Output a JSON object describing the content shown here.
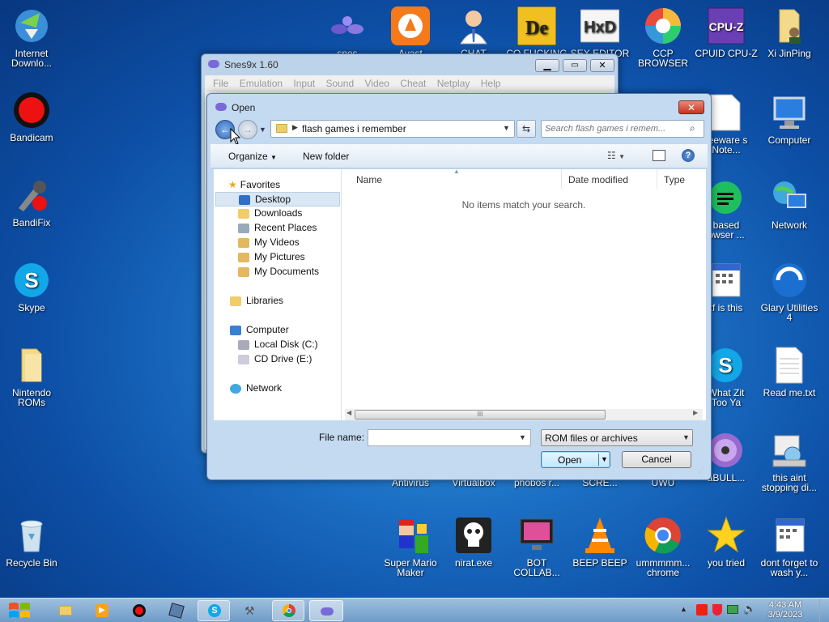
{
  "desktop": {
    "left_icons": [
      {
        "label": "Internet Downlo...",
        "icon": "idm-icon"
      },
      {
        "label": "Bandicam",
        "icon": "bandicam-icon"
      },
      {
        "label": "BandiFix",
        "icon": "bandifix-icon"
      },
      {
        "label": "Skype",
        "icon": "skype-icon"
      },
      {
        "label": "Nintendo ROMs",
        "icon": "folder-icon"
      },
      {
        "label": "Recycle Bin",
        "icon": "recycle-bin-icon"
      }
    ],
    "top_icons": [
      {
        "label": "snes",
        "icon": "snes-icon"
      },
      {
        "label": "Avast",
        "icon": "avast-icon"
      },
      {
        "label": "CHAT",
        "icon": "user-icon"
      },
      {
        "label": "CO FUCKING",
        "icon": "de-icon"
      },
      {
        "label": "SEX EDITOR",
        "icon": "hxd-icon"
      },
      {
        "label": "CCP BROWSER",
        "icon": "browser-icon"
      },
      {
        "label": "CPUID CPU-Z",
        "icon": "cpuz-icon"
      },
      {
        "label": "Xi JinPing",
        "icon": "folder-user-icon"
      }
    ],
    "right_col_a": [
      {
        "label": "reeware s Note...",
        "icon": "document-icon"
      },
      {
        "label": "based owser ...",
        "icon": "green-app-icon"
      },
      {
        "label": "tf is this",
        "icon": "calendar-icon"
      },
      {
        "label": "What Zit Too Ya",
        "icon": "skype-icon"
      },
      {
        "label": "aBULL...",
        "icon": "disc-icon"
      }
    ],
    "right_col_b": [
      {
        "label": "Computer",
        "icon": "computer-icon"
      },
      {
        "label": "Network",
        "icon": "network-icon"
      },
      {
        "label": "Glary Utilities 4",
        "icon": "glary-icon"
      },
      {
        "label": "Read me.txt",
        "icon": "text-file-icon"
      },
      {
        "label": "this aint stopping di...",
        "icon": "installer-icon"
      }
    ],
    "mid_row": [
      {
        "label": "Antivirus"
      },
      {
        "label": "Virtualbox"
      },
      {
        "label": "phobos r..."
      },
      {
        "label": "SCRE..."
      },
      {
        "label": "UWU"
      }
    ],
    "bottom_icons": [
      {
        "label": "Super Mario Maker",
        "icon": "mario-icon"
      },
      {
        "label": "nirat.exe",
        "icon": "skull-icon"
      },
      {
        "label": "BOT COLLAB...",
        "icon": "monitor-icon"
      },
      {
        "label": "BEEP BEEP",
        "icon": "vlc-icon"
      },
      {
        "label": "ummmmm... chrome",
        "icon": "chrome-icon"
      },
      {
        "label": "you tried",
        "icon": "star-icon"
      },
      {
        "label": "dont forget to wash y...",
        "icon": "calendar-icon"
      }
    ]
  },
  "snes_window": {
    "title": "Snes9x 1.60",
    "menu": [
      "File",
      "Emulation",
      "Input",
      "Sound",
      "Video",
      "Cheat",
      "Netplay",
      "Help"
    ]
  },
  "open_dialog": {
    "title": "Open",
    "breadcrumb": "flash games i remember",
    "search_placeholder": "Search flash games i remem...",
    "organize": "Organize",
    "new_folder": "New folder",
    "nav": {
      "favorites": "Favorites",
      "desktop": "Desktop",
      "downloads": "Downloads",
      "recent": "Recent Places",
      "videos": "My Videos",
      "pictures": "My Pictures",
      "documents": "My Documents",
      "libraries": "Libraries",
      "computer": "Computer",
      "local_disk": "Local Disk (C:)",
      "cd_drive": "CD Drive (E:)",
      "network": "Network"
    },
    "columns": {
      "name": "Name",
      "date": "Date modified",
      "type": "Type"
    },
    "empty_message": "No items match your search.",
    "scroll_grip": "III",
    "file_name_label": "File name:",
    "file_name_value": "",
    "file_type": "ROM files or archives",
    "open_button": "Open",
    "cancel_button": "Cancel"
  },
  "taskbar": {
    "time": "4:43 AM",
    "date": "3/9/2023"
  }
}
